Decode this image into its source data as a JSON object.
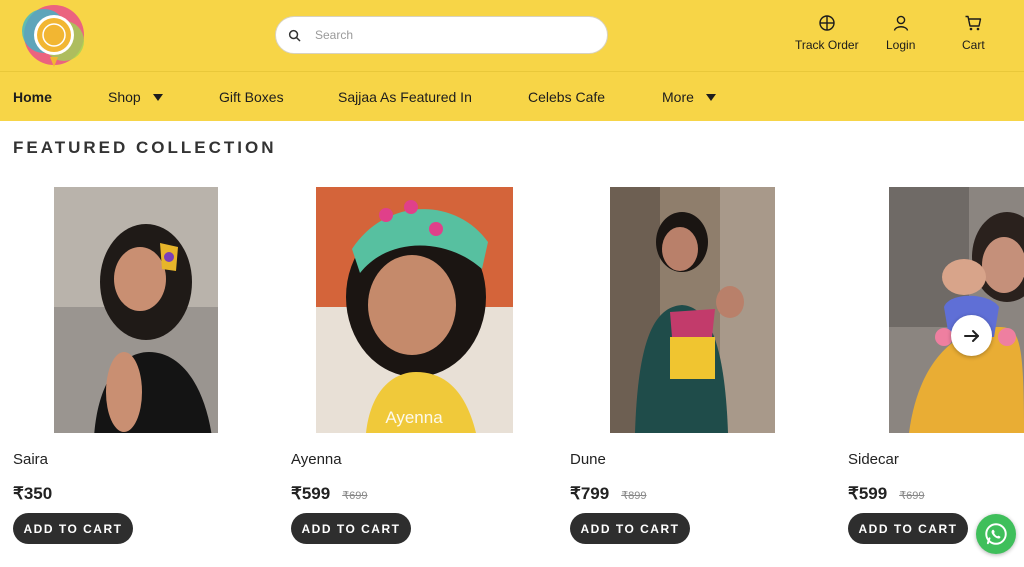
{
  "brand": {
    "logo_icon": "brand-logo-icon"
  },
  "header": {
    "search_placeholder": "Search",
    "track_order_label": "Track Order",
    "login_label": "Login",
    "cart_label": "Cart"
  },
  "nav": {
    "items": [
      {
        "label": "Home",
        "active": true
      },
      {
        "label": "Shop",
        "dropdown": true
      },
      {
        "label": "Gift Boxes"
      },
      {
        "label": "Sajjaa As Featured In"
      },
      {
        "label": "Celebs Cafe"
      },
      {
        "label": "More",
        "dropdown": true
      }
    ]
  },
  "section": {
    "title": "FEATURED COLLECTION"
  },
  "products": [
    {
      "name": "Saira",
      "price": "₹350",
      "old_price": "",
      "button": "ADD TO CART"
    },
    {
      "name": "Ayenna",
      "price": "₹599",
      "old_price": "₹699",
      "button": "ADD TO CART",
      "image_caption": "Ayenna"
    },
    {
      "name": "Dune",
      "price": "₹799",
      "old_price": "₹899",
      "button": "ADD TO CART"
    },
    {
      "name": "Sidecar",
      "price": "₹599",
      "old_price": "₹699",
      "button": "ADD TO CART"
    }
  ],
  "colors": {
    "brand_yellow": "#f7d547",
    "button_dark": "#2e2e2e",
    "whatsapp_green": "#3fbf5b"
  }
}
